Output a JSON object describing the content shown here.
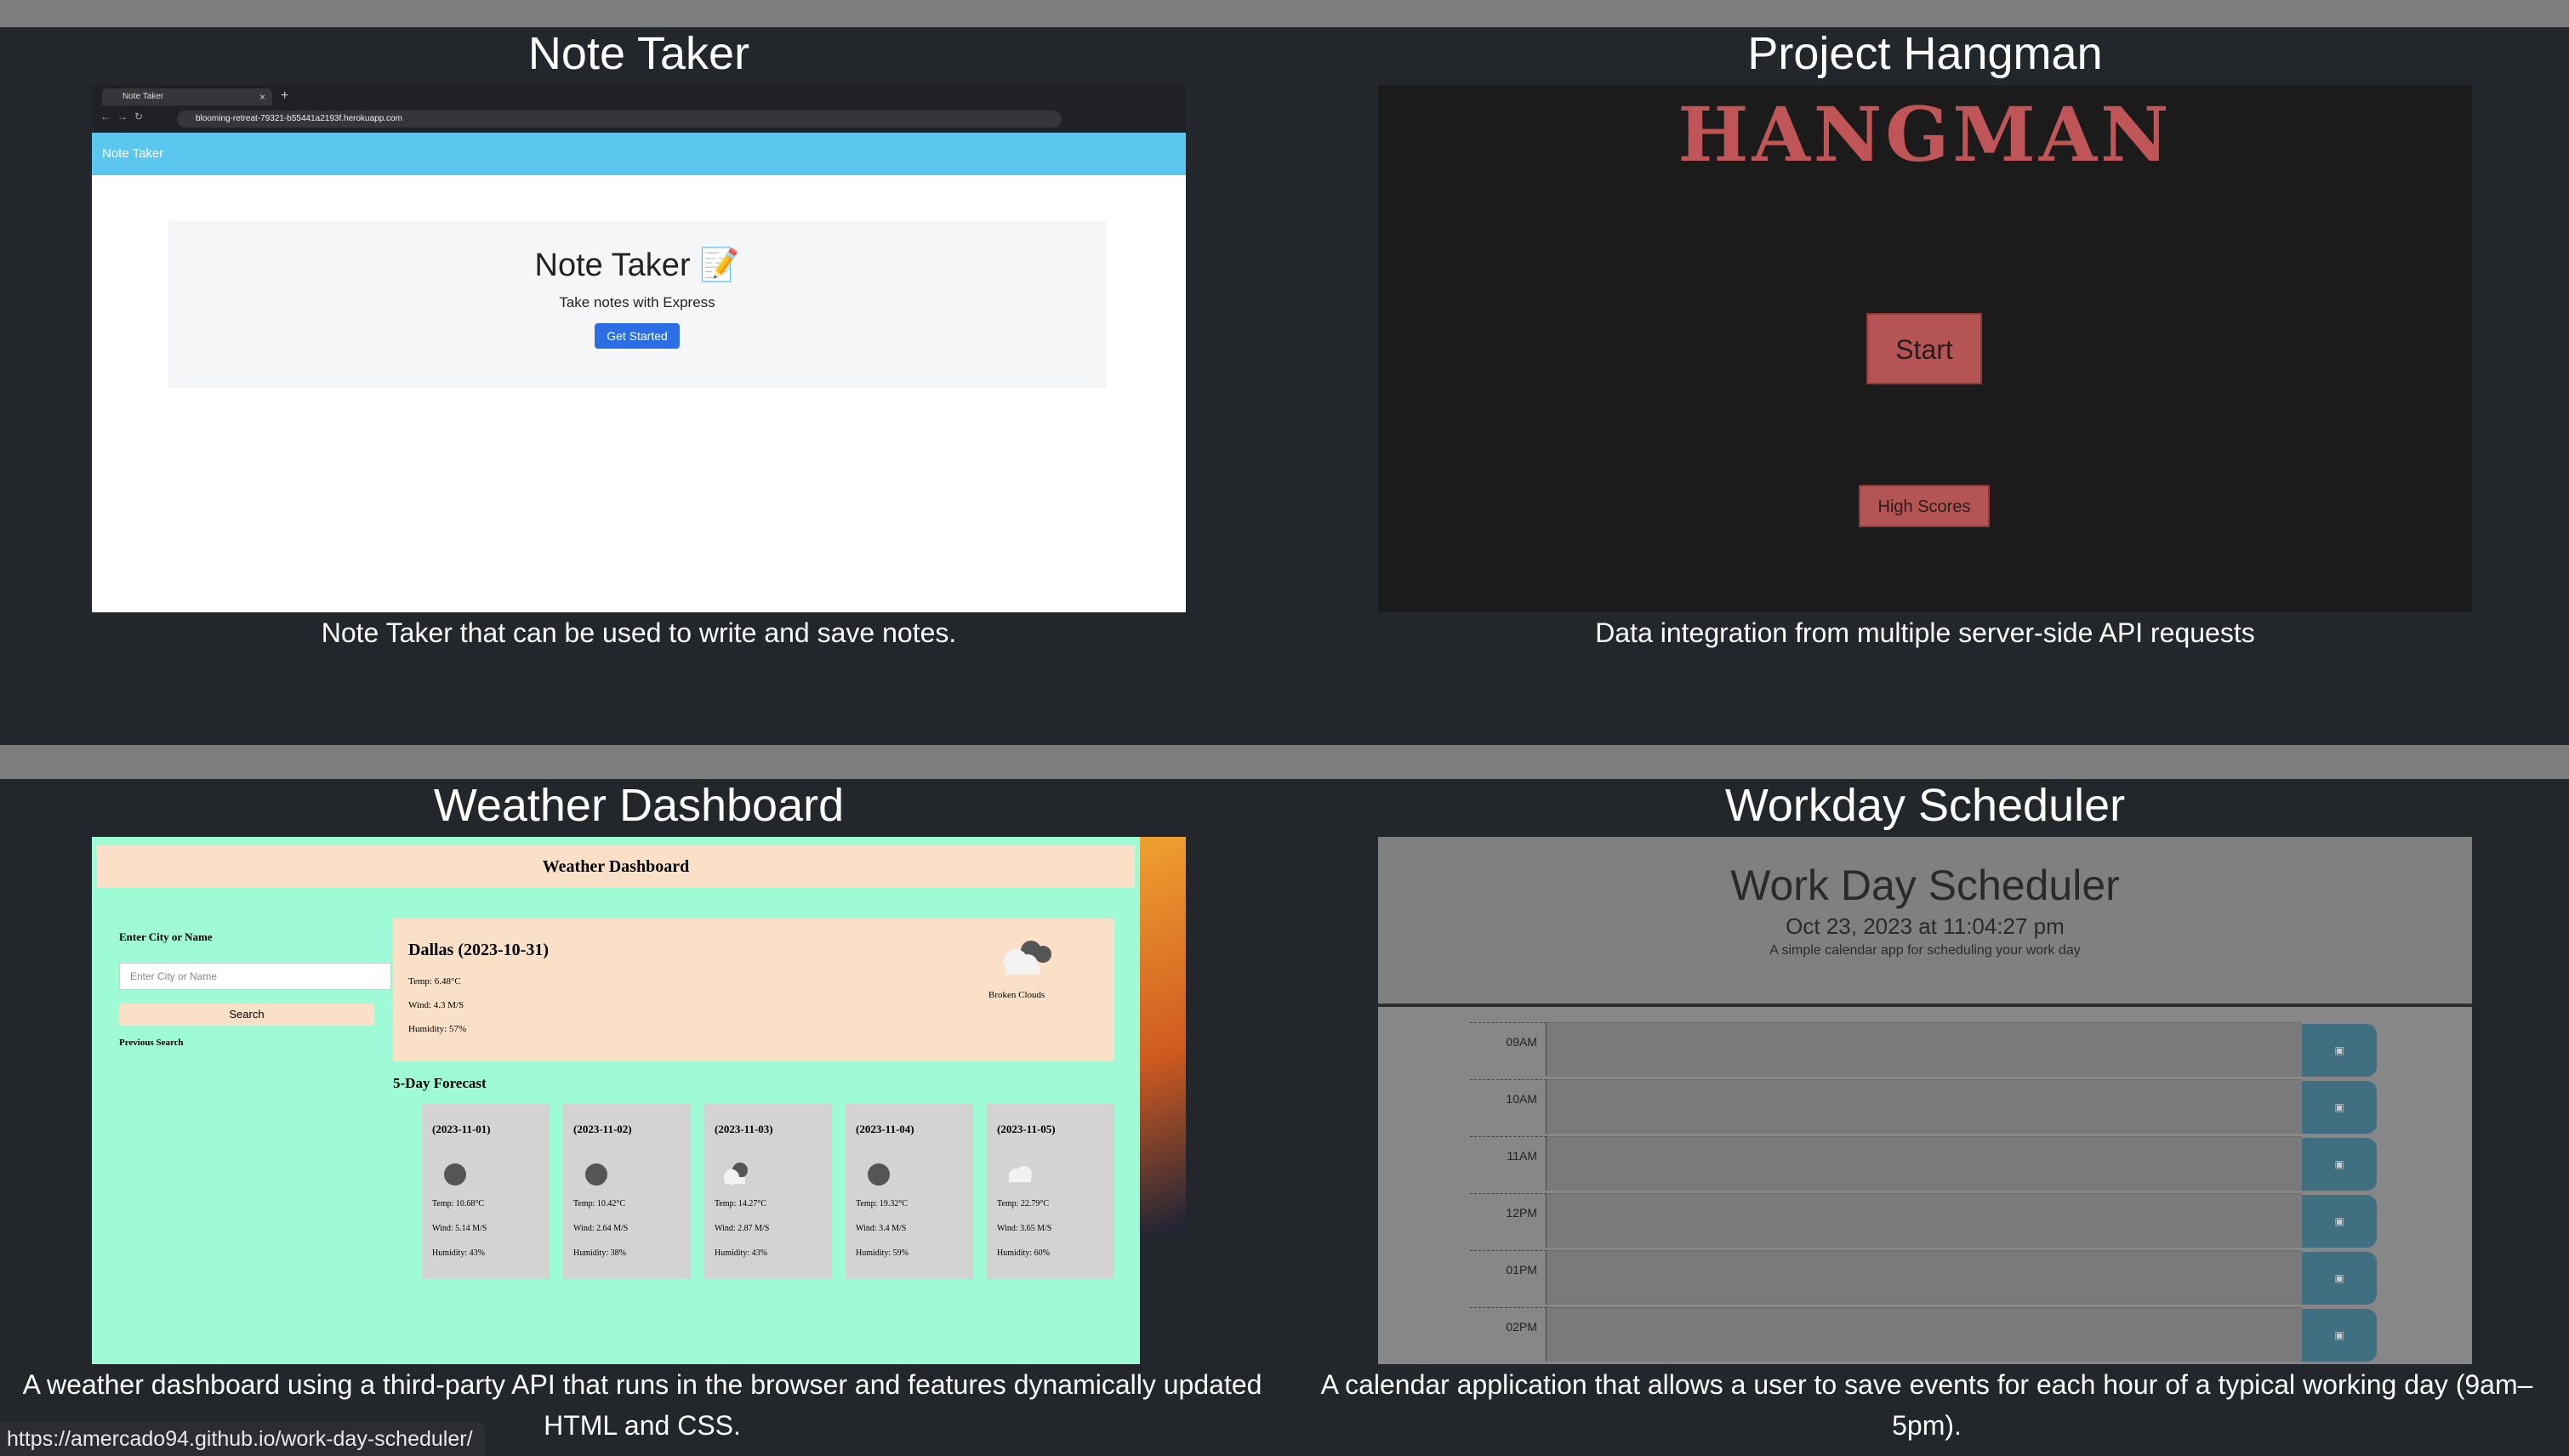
{
  "projects": [
    {
      "title": "Note Taker",
      "description": "Note Taker that can be used to write and save notes.",
      "screenshot": {
        "tab_label": "Note Taker",
        "url": "blooming-retreat-79321-b55441a2193f.herokuapp.com",
        "navbar_label": "Note Taker",
        "heading": "Note Taker 📝",
        "subheading": "Take notes with Express",
        "button_label": "Get Started"
      }
    },
    {
      "title": "Project Hangman",
      "description": "Data integration from multiple server-side API requests",
      "screenshot": {
        "logo": "HANGMAN",
        "start_label": "Start",
        "high_scores_label": "High Scores"
      }
    },
    {
      "title": "Weather Dashboard",
      "description": "A weather dashboard using a third-party API that runs in the browser and features dynamically updated HTML and CSS.",
      "screenshot": {
        "header": "Weather Dashboard",
        "search_label": "Enter City or Name",
        "search_placeholder": "Enter City or Name",
        "search_button": "Search",
        "previous_label": "Previous Search",
        "current": {
          "city": "Dallas (2023-10-31)",
          "temp": "Temp: 6.48°C",
          "wind": "Wind: 4.3 M/S",
          "humidity": "Humidity: 57%",
          "condition": "Broken Clouds"
        },
        "forecast_heading": "5-Day Forecast",
        "forecast": [
          {
            "date": "(2023-11-01)",
            "temp": "Temp: 10.68°C",
            "wind": "Wind: 5.14 M/S",
            "humidity": "Humidity: 43%"
          },
          {
            "date": "(2023-11-02)",
            "temp": "Temp: 10.42°C",
            "wind": "Wind: 2.64 M/S",
            "humidity": "Humidity: 38%"
          },
          {
            "date": "(2023-11-03)",
            "temp": "Temp: 14.27°C",
            "wind": "Wind: 2.87 M/S",
            "humidity": "Humidity: 43%"
          },
          {
            "date": "(2023-11-04)",
            "temp": "Temp: 19.32°C",
            "wind": "Wind: 3.4 M/S",
            "humidity": "Humidity: 59%"
          },
          {
            "date": "(2023-11-05)",
            "temp": "Temp: 22.79°C",
            "wind": "Wind: 3.65 M/S",
            "humidity": "Humidity: 60%"
          }
        ]
      }
    },
    {
      "title": "Workday Scheduler",
      "description": "A calendar application that allows a user to save events for each hour of a typical working day (9am–5pm).",
      "screenshot": {
        "heading": "Work Day Scheduler",
        "date": "Oct 23, 2023 at 11:04:27 pm",
        "tagline": "A simple calendar app for scheduling your work day",
        "hours": [
          "09AM",
          "10AM",
          "11AM",
          "12PM",
          "01PM",
          "02PM"
        ]
      }
    }
  ],
  "status_url": "https://amercado94.github.io/work-day-scheduler/"
}
